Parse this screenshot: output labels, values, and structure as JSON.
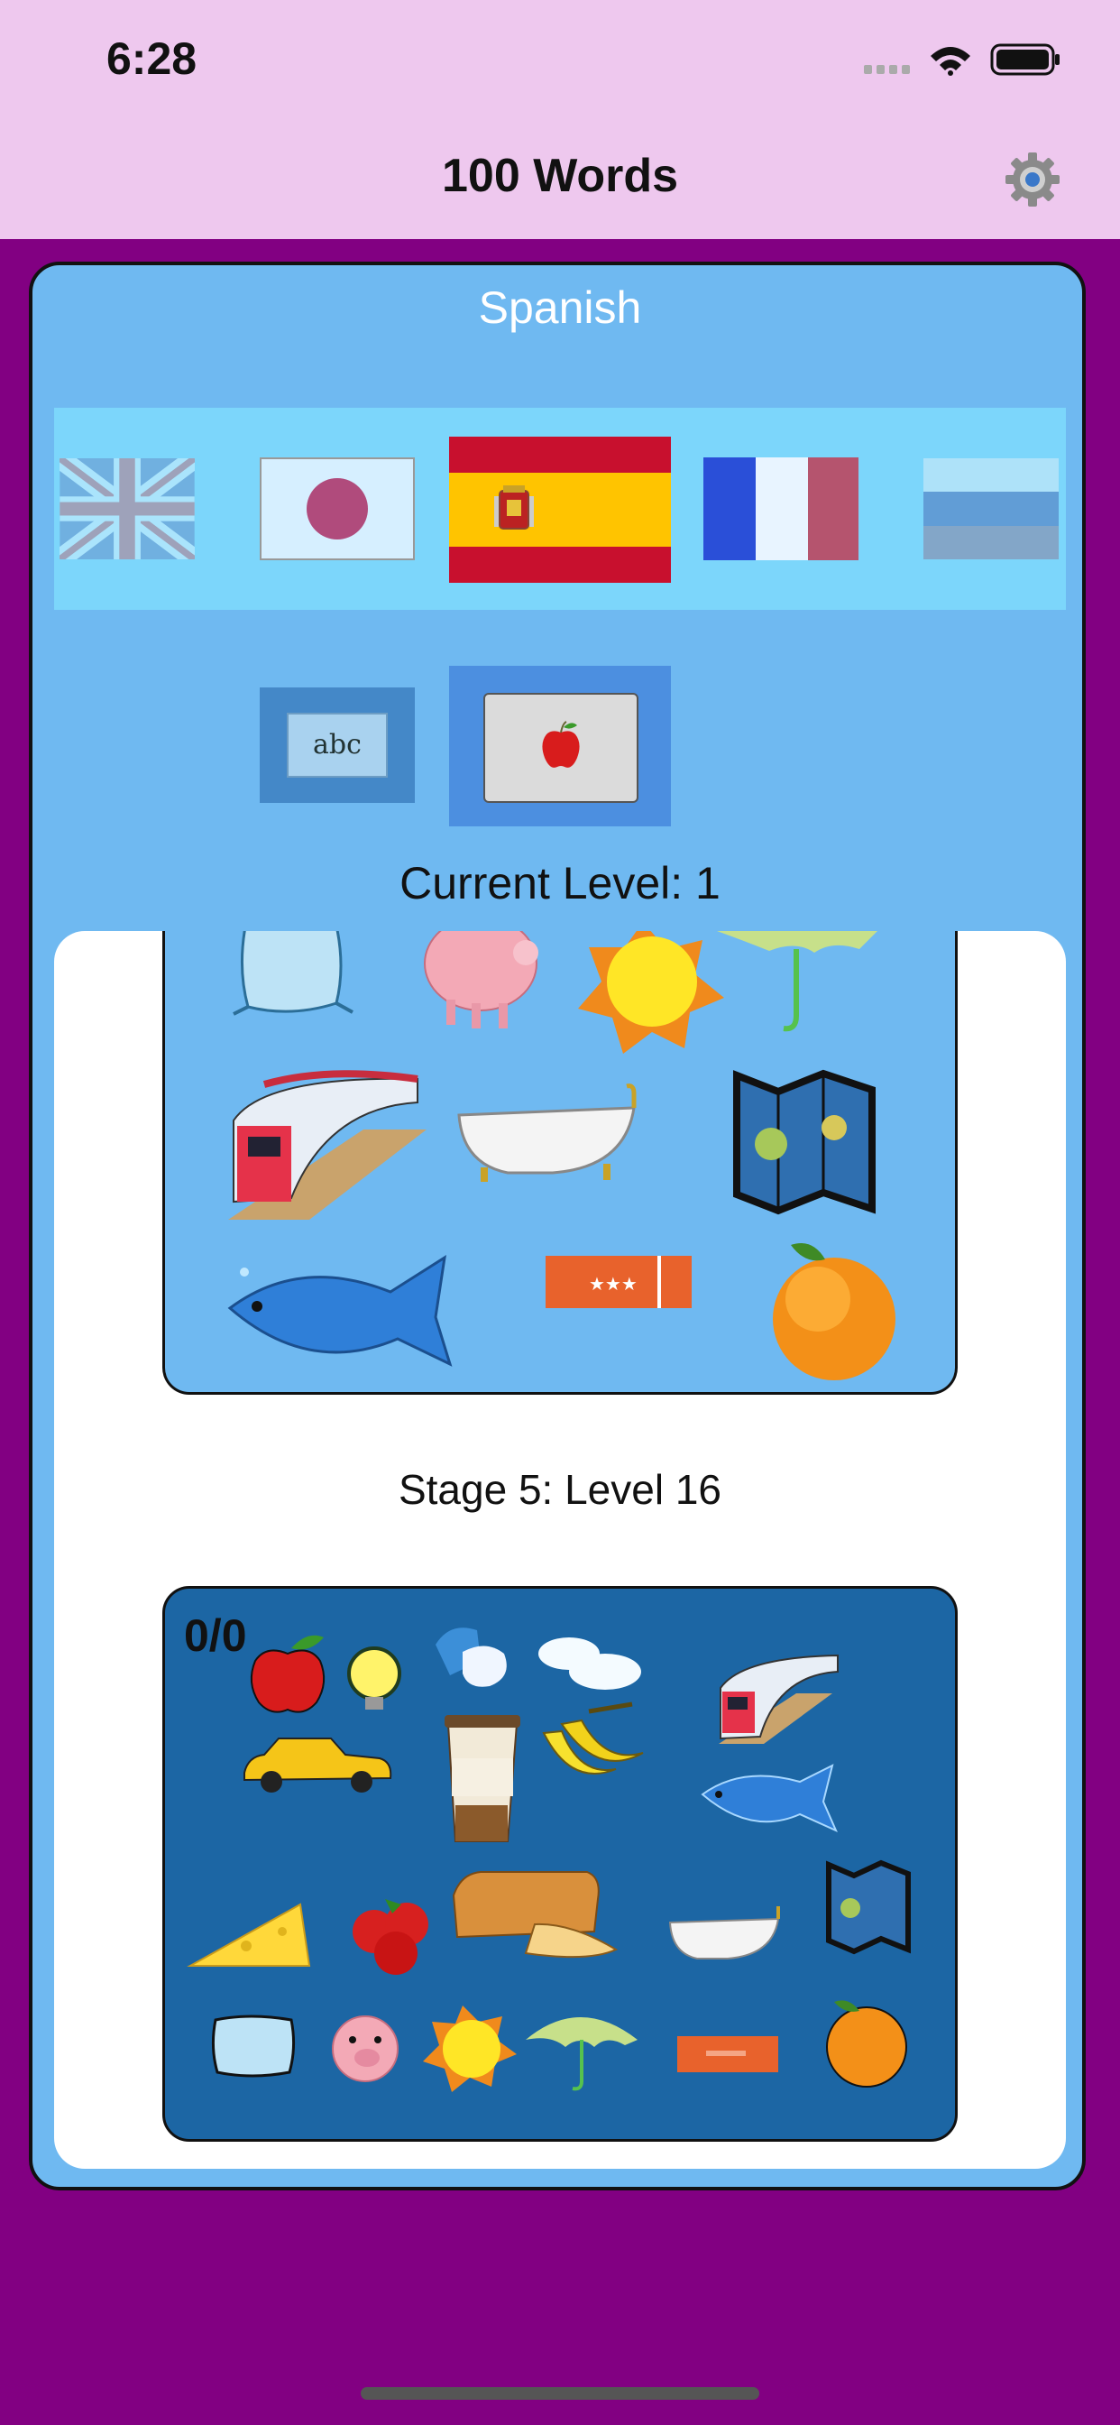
{
  "status_bar": {
    "time": "6:28"
  },
  "nav": {
    "title": "100 Words",
    "settings_icon": "gear-icon"
  },
  "language": {
    "selected": "Spanish",
    "flags": [
      {
        "name": "English",
        "icon": "uk-flag-icon",
        "selected": false
      },
      {
        "name": "Japanese",
        "icon": "japan-flag-icon",
        "selected": false
      },
      {
        "name": "Spanish",
        "icon": "spain-flag-icon",
        "selected": true
      },
      {
        "name": "French",
        "icon": "france-flag-icon",
        "selected": false
      },
      {
        "name": "Russian",
        "icon": "russia-flag-icon",
        "selected": false
      }
    ]
  },
  "mode": {
    "text_mode_label": "abc",
    "picture_mode_icon": "apple-icon",
    "selected": "picture"
  },
  "level": {
    "current_level": "Current Level: 1"
  },
  "stage": {
    "label": "Stage 5: Level 16",
    "score": "0/0"
  },
  "preview_top_items": [
    "pillow-icon",
    "pig-icon",
    "sun-icon",
    "umbrella-icon",
    "train-icon",
    "bathtub-icon",
    "map-icon",
    "fish-icon",
    "ticket-icon",
    "orange-icon"
  ],
  "preview_bottom_items": [
    "apple-icon",
    "lightbulb-icon",
    "weather-icon",
    "clouds-icon",
    "train-icon",
    "taxi-icon",
    "coffee-icon",
    "banana-icon",
    "fish-icon",
    "cheese-icon",
    "tomato-icon",
    "bread-icon",
    "bathtub-icon",
    "map-icon",
    "pillow-icon",
    "pig-icon",
    "sun-icon",
    "umbrella-icon",
    "ticket-icon",
    "orange-icon"
  ],
  "colors": {
    "background": "#820082",
    "bar": "#eec8ee",
    "card": "#6fb9f1",
    "strip": "#7cd6fb",
    "preview_dark": "#1c66a4"
  }
}
